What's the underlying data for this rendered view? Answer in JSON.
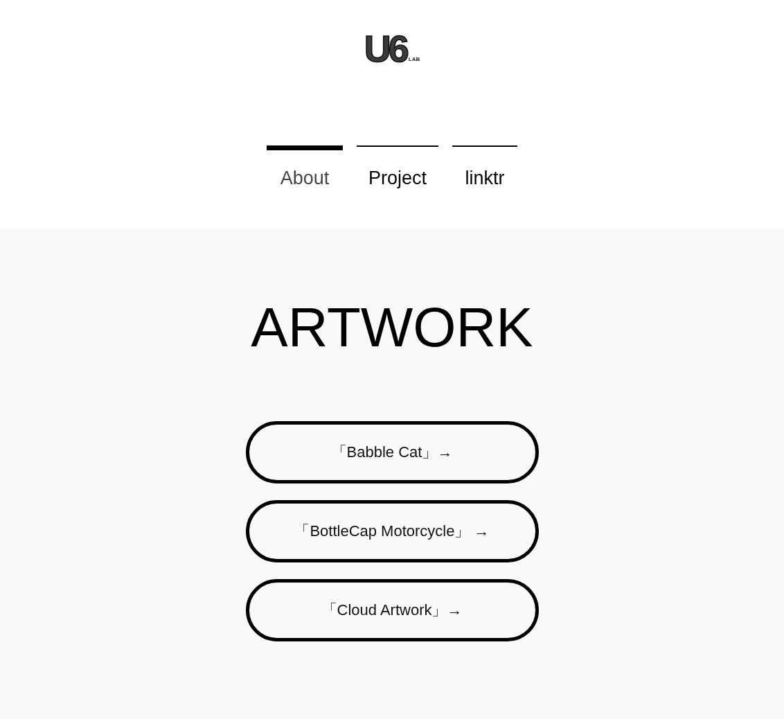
{
  "logo": {
    "mark": "U6",
    "sub": "LAB"
  },
  "nav": {
    "tabs": [
      {
        "label": "About",
        "selected": true
      },
      {
        "label": "Project",
        "selected": false
      },
      {
        "label": "linktr",
        "selected": false
      }
    ]
  },
  "section": {
    "title": "ARTWORK",
    "links": [
      {
        "label": "「Babble Cat」→"
      },
      {
        "label": "「BottleCap Motorcycle」 →"
      },
      {
        "label": "「Cloud Artwork」→"
      }
    ]
  }
}
